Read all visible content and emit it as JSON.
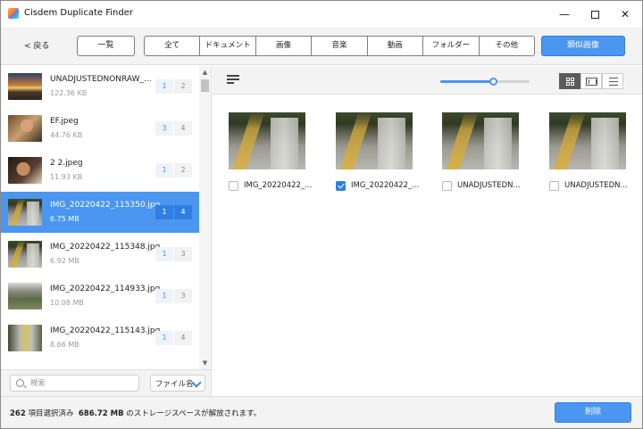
{
  "window": {
    "title": "Cisdem Duplicate Finder"
  },
  "toolbar": {
    "back_label": "< 戻る",
    "list_label": "一覧",
    "filters": [
      "全て",
      "ドキュメント",
      "画像",
      "音楽",
      "動画",
      "フォルダー",
      "その他"
    ],
    "similar_label": "類似画像"
  },
  "file_list": [
    {
      "name": "UNADJUSTEDNONRAW_...",
      "size": "122.36 KB",
      "count_a": "1",
      "count_b": "2",
      "thumb": "sunset",
      "selected": false
    },
    {
      "name": "EF.jpeg",
      "size": "44.76 KB",
      "count_a": "3",
      "count_b": "4",
      "thumb": "girl1",
      "selected": false
    },
    {
      "name": "2 2.jpeg",
      "size": "11.93 KB",
      "count_a": "1",
      "count_b": "2",
      "thumb": "girl2",
      "selected": false
    },
    {
      "name": "IMG_20220422_115350.jpg",
      "size": "6.75 MB",
      "count_a": "1",
      "count_b": "4",
      "thumb": "boardwalk",
      "selected": true
    },
    {
      "name": "IMG_20220422_115348.jpg",
      "size": "6.92 MB",
      "count_a": "1",
      "count_b": "3",
      "thumb": "boardwalk",
      "selected": false
    },
    {
      "name": "IMG_20220422_114933.jpg",
      "size": "10.08 MB",
      "count_a": "1",
      "count_b": "3",
      "thumb": "path",
      "selected": false
    },
    {
      "name": "IMG_20220422_115143.jpg",
      "size": "8.66 MB",
      "count_a": "1",
      "count_b": "4",
      "thumb": "rail",
      "selected": false
    }
  ],
  "search": {
    "placeholder": "検索",
    "value": ""
  },
  "sort": {
    "selected": "ファイル名"
  },
  "view": {
    "thumbnail_size_percent": 60,
    "active_mode": "grid"
  },
  "cards": [
    {
      "label": "IMG_20220422_...",
      "checked": false
    },
    {
      "label": "IMG_20220422_...",
      "checked": true
    },
    {
      "label": "UNADJUSTEDN...",
      "checked": false
    },
    {
      "label": "UNADJUSTEDN...",
      "checked": false
    }
  ],
  "footer": {
    "count": "262",
    "count_suffix": "項目選択済み",
    "size": "686.72 MB",
    "size_suffix": "のストレージスペースが解放されます。",
    "delete_label": "削除"
  },
  "icons": {
    "sort": "sort-lines-icon",
    "search": "search-icon",
    "dropdown": "chevron-down-icon",
    "views": [
      "grid-icon",
      "film-icon",
      "list-icon"
    ]
  },
  "colors": {
    "accent": "#4a96f0",
    "accent_dark": "#2f7fe0",
    "toolbar_bg": "#f3f3f3"
  }
}
